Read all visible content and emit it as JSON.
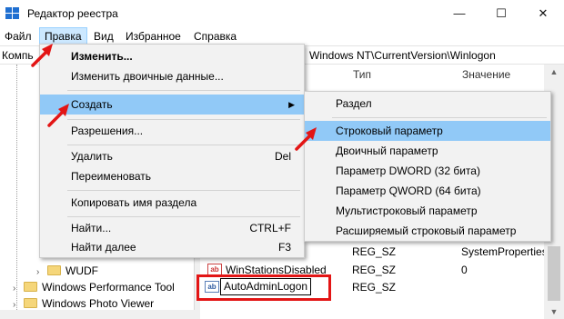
{
  "window": {
    "title": "Редактор реестра"
  },
  "menubar": {
    "file": "Файл",
    "edit": "Правка",
    "view": "Вид",
    "favorites": "Избранное",
    "help": "Справка"
  },
  "address": {
    "prefix": "Компь",
    "path": "Windows NT\\CurrentVersion\\Winlogon"
  },
  "columns": {
    "type": "Тип",
    "value": "Значение"
  },
  "tree": {
    "items": [
      {
        "label": "WUDF"
      },
      {
        "label": "Windows Performance Tool"
      },
      {
        "label": "Windows Photo Viewer"
      }
    ]
  },
  "rows": [
    {
      "name": "",
      "type": "REG_SZ",
      "value": "SystemProperties"
    },
    {
      "name": "WinStationsDisabled",
      "type": "REG_SZ",
      "value": "0"
    },
    {
      "name": "AutoAdminLogon",
      "type": "REG_SZ",
      "value": ""
    }
  ],
  "edit_menu": {
    "items": [
      {
        "label": "Изменить...",
        "shortcut": ""
      },
      {
        "label": "Изменить двоичные данные...",
        "shortcut": ""
      },
      {
        "label": "Создать",
        "shortcut": ""
      },
      {
        "label": "Разрешения...",
        "shortcut": ""
      },
      {
        "label": "Удалить",
        "shortcut": "Del"
      },
      {
        "label": "Переименовать",
        "shortcut": ""
      },
      {
        "label": "Копировать имя раздела",
        "shortcut": ""
      },
      {
        "label": "Найти...",
        "shortcut": "CTRL+F"
      },
      {
        "label": "Найти далее",
        "shortcut": "F3"
      }
    ]
  },
  "create_menu": {
    "items": [
      {
        "label": "Раздел"
      },
      {
        "label": "Строковый параметр"
      },
      {
        "label": "Двоичный параметр"
      },
      {
        "label": "Параметр DWORD (32 бита)"
      },
      {
        "label": "Параметр QWORD (64 бита)"
      },
      {
        "label": "Мультистроковый параметр"
      },
      {
        "label": "Расширяемый строковый параметр"
      }
    ]
  },
  "colors": {
    "highlight": "#91c9f7",
    "annotation": "#e31515",
    "menu_bg": "#f2f2f2"
  },
  "icons": {
    "string_value": "ab"
  }
}
